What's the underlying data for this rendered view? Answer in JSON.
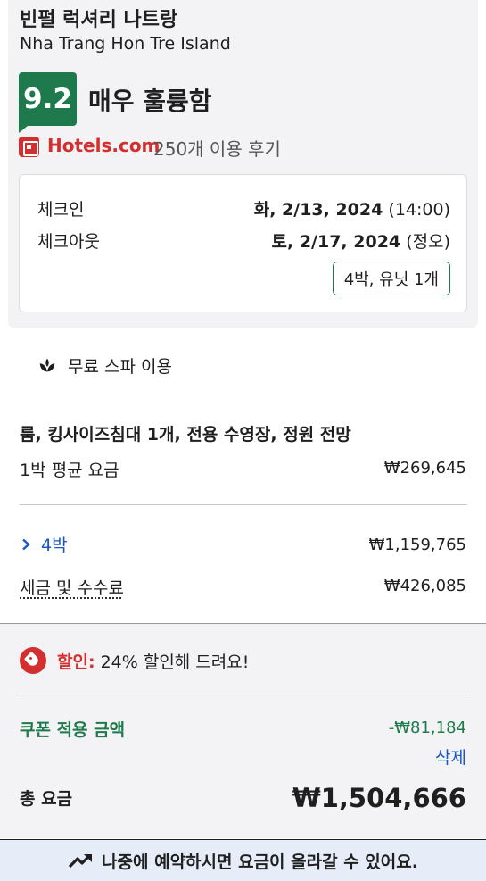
{
  "hotel": {
    "name": "빈펄 럭셔리 나트랑",
    "location": "Nha Trang Hon Tre Island"
  },
  "rating": {
    "score": "9.2",
    "label": "매우 훌륭함"
  },
  "reviews": {
    "brand": "Hotels.com",
    "count_text": "250개 이용 후기",
    "brand_color": "#d32f2f"
  },
  "stay": {
    "checkin_label": "체크인",
    "checkin_date": "화, 2/13, 2024",
    "checkin_time": "(14:00)",
    "checkout_label": "체크아웃",
    "checkout_date": "토, 2/17, 2024",
    "checkout_time": "(정오)",
    "nights_units": "4박, 유닛 1개"
  },
  "amenity": {
    "icon": "spa-icon",
    "text": "무료 스파 이용"
  },
  "room": {
    "title": "룸, 킹사이즈침대 1개, 전용 수영장, 정원 전망",
    "avg_label": "1박 평균 요금",
    "avg_value": "₩269,645"
  },
  "price_breakdown": {
    "nights_label": "4박",
    "nights_value": "₩1,159,765",
    "taxes_label": "세금 및 수수료",
    "taxes_value": "₩426,085"
  },
  "discount": {
    "label": "할인:",
    "text": "24% 할인해 드려요!"
  },
  "coupon": {
    "label": "쿠폰 적용 금액",
    "amount": "-₩81,184",
    "remove_label": "삭제"
  },
  "total": {
    "label": "총 요금",
    "amount": "₩1,504,666"
  },
  "banner": {
    "text": "나중에 예약하시면 요금이 올라갈 수 있어요."
  },
  "colors": {
    "accent_green": "#1e7a4c",
    "link_blue": "#1a56c4",
    "alert_red": "#d32f2f",
    "banner_bg": "#e6ecf8"
  }
}
